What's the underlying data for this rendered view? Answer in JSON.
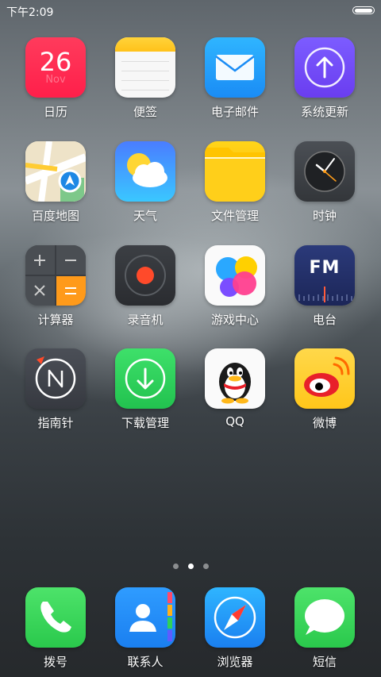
{
  "status": {
    "time": "下午2:09"
  },
  "calendar_day": "26",
  "calendar_month": "Nov",
  "apps": {
    "calendar": "日历",
    "notes": "便签",
    "email": "电子邮件",
    "update": "系统更新",
    "maps": "百度地图",
    "weather": "天气",
    "files": "文件管理",
    "clock": "时钟",
    "calculator": "计算器",
    "recorder": "录音机",
    "gamecenter": "游戏中心",
    "radio": "电台",
    "compass": "指南针",
    "downloads": "下载管理",
    "qq": "QQ",
    "weibo": "微博"
  },
  "radio_icon_text": "FM",
  "dock": {
    "phone": "拨号",
    "contacts": "联系人",
    "browser": "浏览器",
    "messages": "短信"
  },
  "page_indicator": {
    "pages": 3,
    "current": 2
  }
}
